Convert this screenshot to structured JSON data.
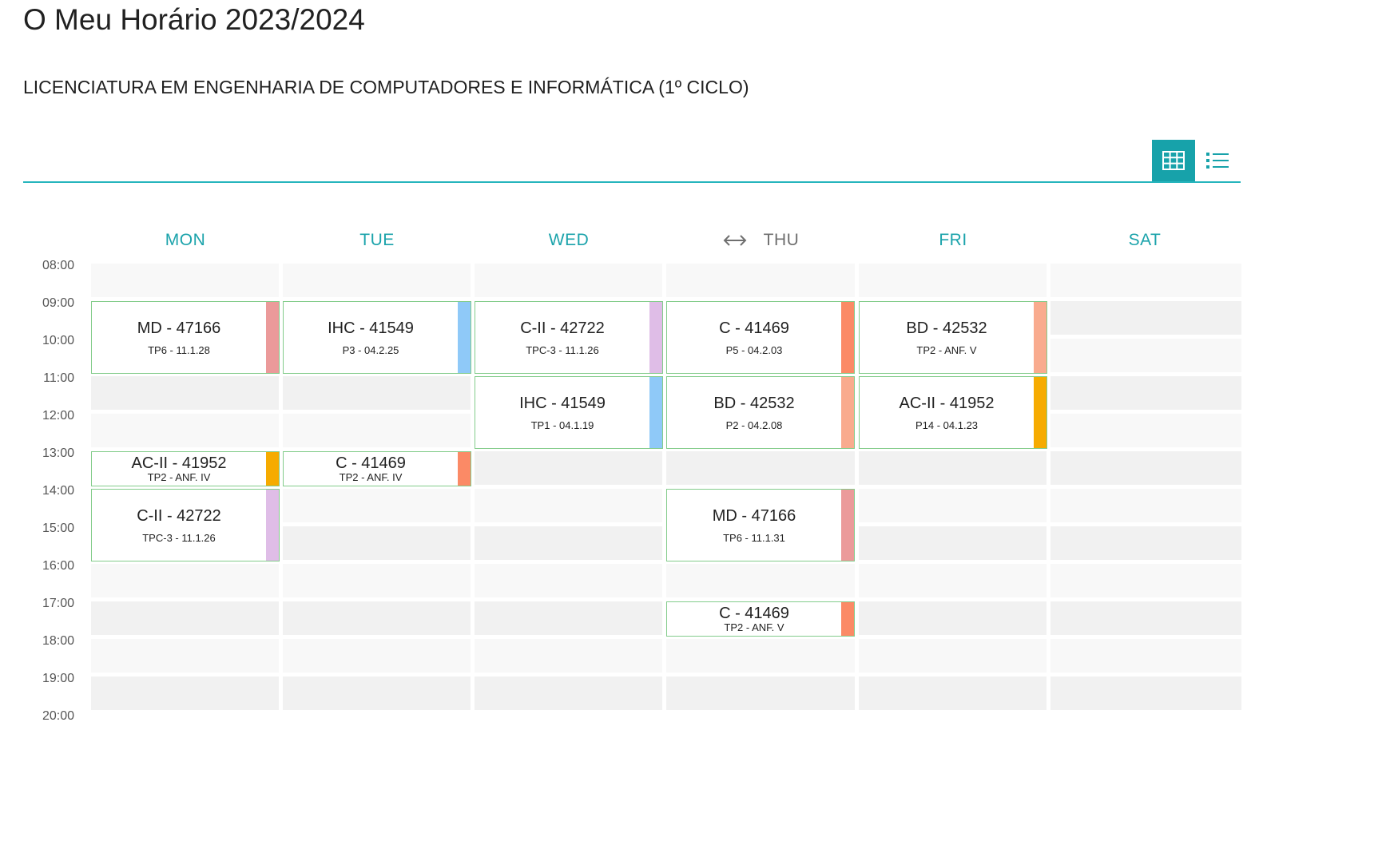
{
  "page_title": "O Meu Horário 2023/2024",
  "program": "LICENCIATURA EM ENGENHARIA DE COMPUTADORES E INFORMÁTICA (1º CICLO)",
  "view_toggle": {
    "active": "grid",
    "accent": "#17a2aa"
  },
  "days": [
    "MON",
    "TUE",
    "WED",
    "THU",
    "FRI",
    "SAT"
  ],
  "times": [
    "08:00",
    "09:00",
    "10:00",
    "11:00",
    "12:00",
    "13:00",
    "14:00",
    "15:00",
    "16:00",
    "17:00",
    "18:00",
    "19:00",
    "20:00"
  ],
  "events": [
    {
      "day": "MON",
      "start": "09:00",
      "end": "11:00",
      "course": "MD - 47166",
      "room": "TP6 - 11.1.28",
      "color": "#eb9a9a"
    },
    {
      "day": "MON",
      "start": "13:00",
      "end": "14:00",
      "course": "AC-II - 41952",
      "room": "TP2 - ANF. IV",
      "color": "#f6ab00"
    },
    {
      "day": "MON",
      "start": "14:00",
      "end": "16:00",
      "course": "C-II - 42722",
      "room": "TPC-3 - 11.1.26",
      "color": "#dfbde7"
    },
    {
      "day": "TUE",
      "start": "09:00",
      "end": "11:00",
      "course": "IHC - 41549",
      "room": "P3 - 04.2.25",
      "color": "#8fc9f8"
    },
    {
      "day": "TUE",
      "start": "13:00",
      "end": "14:00",
      "course": "C - 41469",
      "room": "TP2 - ANF. IV",
      "color": "#fb8a66"
    },
    {
      "day": "WED",
      "start": "09:00",
      "end": "11:00",
      "course": "C-II - 42722",
      "room": "TPC-3 - 11.1.26",
      "color": "#dfbde7"
    },
    {
      "day": "WED",
      "start": "11:00",
      "end": "13:00",
      "course": "IHC - 41549",
      "room": "TP1 - 04.1.19",
      "color": "#8fc9f8"
    },
    {
      "day": "THU",
      "start": "09:00",
      "end": "11:00",
      "course": "C - 41469",
      "room": "P5 - 04.2.03",
      "color": "#fb8a66"
    },
    {
      "day": "THU",
      "start": "11:00",
      "end": "13:00",
      "course": "BD - 42532",
      "room": "P2 - 04.2.08",
      "color": "#f9ab8e"
    },
    {
      "day": "THU",
      "start": "14:00",
      "end": "16:00",
      "course": "MD - 47166",
      "room": "TP6 - 11.1.31",
      "color": "#eb9a9a"
    },
    {
      "day": "THU",
      "start": "17:00",
      "end": "18:00",
      "course": "C - 41469",
      "room": "TP2 - ANF. V",
      "color": "#fb8a66"
    },
    {
      "day": "FRI",
      "start": "09:00",
      "end": "11:00",
      "course": "BD - 42532",
      "room": "TP2 - ANF. V",
      "color": "#f9ab8e"
    },
    {
      "day": "FRI",
      "start": "11:00",
      "end": "13:00",
      "course": "AC-II - 41952",
      "room": "P14 - 04.1.23",
      "color": "#f6ab00"
    }
  ]
}
